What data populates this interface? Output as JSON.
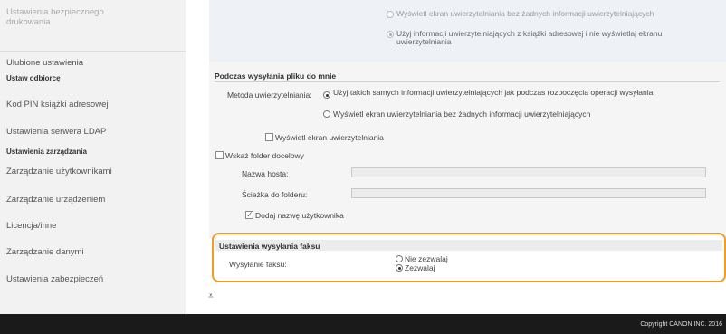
{
  "sidebar": {
    "items": [
      {
        "label": "Ustawienia bezpiecznego drukowania"
      },
      {
        "label": "Ulubione ustawienia"
      },
      {
        "label": "Kod PIN książki adresowej"
      },
      {
        "label": "Ustawienia serwera LDAP"
      },
      {
        "label": "Zarządzanie użytkownikami"
      },
      {
        "label": "Zarządzanie urządzeniem"
      },
      {
        "label": "Licencja/inne"
      },
      {
        "label": "Zarządzanie danymi"
      },
      {
        "label": "Ustawienia zabezpieczeń"
      }
    ],
    "sections": [
      {
        "label": "Ustaw odbiorcę"
      },
      {
        "label": "Ustawienia zarządzania"
      }
    ]
  },
  "top_options": {
    "opt1": "Wyświetl ekran uwierzytelniania bez żadnych informacji uwierzytelniających",
    "opt2": "Użyj informacji uwierzytelniających z książki adresowej i nie wyświetlaj ekranu uwierzytelniania"
  },
  "file_send": {
    "title": "Podczas wysyłania pliku do mnie",
    "auth_label": "Metoda uwierzytelniania:",
    "auth_opt1": "Użyj takich samych informacji uwierzytelniających jak podczas rozpoczęcia operacji wysyłania",
    "auth_opt2": "Wyświetl ekran uwierzytelniania bez żadnych informacji uwierzytelniających",
    "show_auth_check": "Wyświetl ekran uwierzytelniania",
    "dest_folder_check": "Wskaż folder docelowy",
    "host_label": "Nazwa hosta:",
    "path_label": "Ścieżka do folderu:",
    "add_user_check": "Dodaj nazwę użytkownika"
  },
  "fax": {
    "title": "Ustawienia wysyłania faksu",
    "label": "Wysyłanie faksu:",
    "opt_deny": "Nie zezwalaj",
    "opt_allow": "Zezwalaj"
  },
  "footer": {
    "copyright": "Copyright CANON INC. 2016"
  },
  "icons": {
    "top": "to-top-icon"
  }
}
